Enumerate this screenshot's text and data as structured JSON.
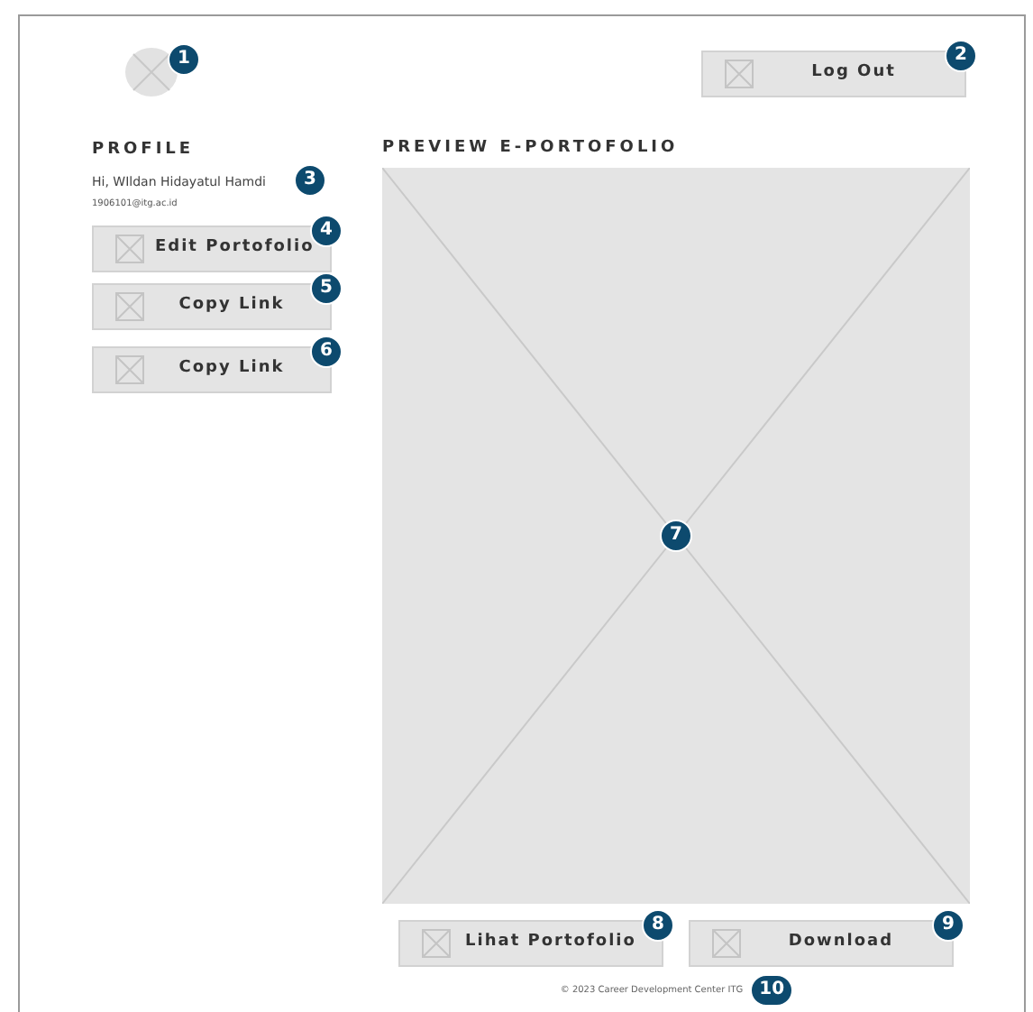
{
  "avatar": {
    "badge": "1"
  },
  "logout_button": {
    "label": "Log Out",
    "badge": "2"
  },
  "profile": {
    "title": "PROFILE",
    "greeting": "Hi, WIldan Hidayatul Hamdi",
    "email": "1906101@itg.ac.id",
    "badge": "3"
  },
  "side_buttons": [
    {
      "label": "Edit Portofolio",
      "badge": "4"
    },
    {
      "label": "Copy Link",
      "badge": "5"
    },
    {
      "label": "Copy Link",
      "badge": "6"
    }
  ],
  "preview": {
    "title": "PREVIEW E-PORTOFOLIO",
    "badge": "7"
  },
  "bottom_buttons": [
    {
      "label": "Lihat Portofolio",
      "badge": "8"
    },
    {
      "label": "Download",
      "badge": "9"
    }
  ],
  "footer": {
    "text": "© 2023 Career Development Center ITG",
    "badge": "10"
  }
}
